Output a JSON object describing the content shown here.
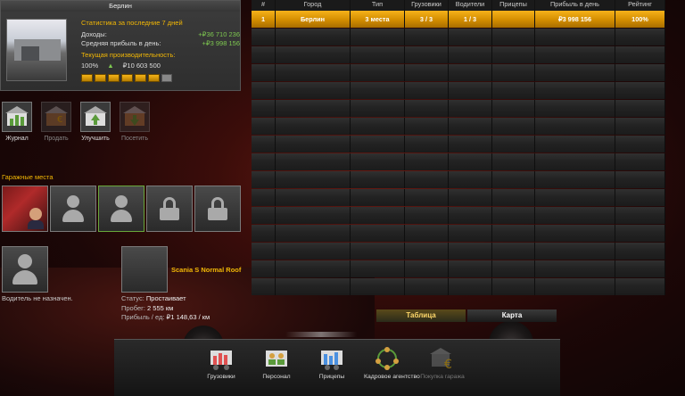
{
  "garage": {
    "city": "Берлин",
    "stats_heading": "Статистика за последние 7 дней",
    "income_label": "Доходы:",
    "income_value": "+₽36 710 236",
    "avg_profit_label": "Средняя прибыль в день:",
    "avg_profit_value": "+₽3 998 156",
    "productivity_label": "Текущая производительность:",
    "productivity_pct": "100%",
    "productivity_value": "₽10 603 500"
  },
  "actions": [
    {
      "label": "Журнал"
    },
    {
      "label": "Продать"
    },
    {
      "label": "Улучшить"
    },
    {
      "label": "Посетить"
    }
  ],
  "garage_slots_label": "Гаражные места",
  "driver": {
    "unassigned": "Водитель не назначен."
  },
  "truck": {
    "name": "Scania S Normal Roof",
    "status_label": "Статус:",
    "status_value": "Простаивает",
    "mileage_label": "Пробег:",
    "mileage_value": "2 555 км",
    "profit_label": "Прибыль / ед:",
    "profit_value": "₽1 148,63 / км"
  },
  "table": {
    "headers": [
      "#",
      "Город",
      "Тип",
      "Грузовики",
      "Водители",
      "Прицепы",
      "Прибыль в день",
      "Рейтинг"
    ],
    "rows": [
      [
        "1",
        "Берлин",
        "3 места",
        "3 / 3",
        "1 / 3",
        "",
        "₽3 998 156",
        "100%"
      ]
    ]
  },
  "tabs": {
    "table": "Таблица",
    "map": "Карта"
  },
  "dock": [
    {
      "label": "Грузовики",
      "icon": "trucks-icon"
    },
    {
      "label": "Персонал",
      "icon": "staff-icon"
    },
    {
      "label": "Прицепы",
      "icon": "trailers-icon"
    },
    {
      "label": "Кадровое агентство",
      "icon": "recruitment-icon"
    },
    {
      "label": "Покупка гаража",
      "icon": "buy-garage-icon"
    }
  ],
  "colors": {
    "accent": "#f2b705",
    "green": "#7ec850"
  }
}
